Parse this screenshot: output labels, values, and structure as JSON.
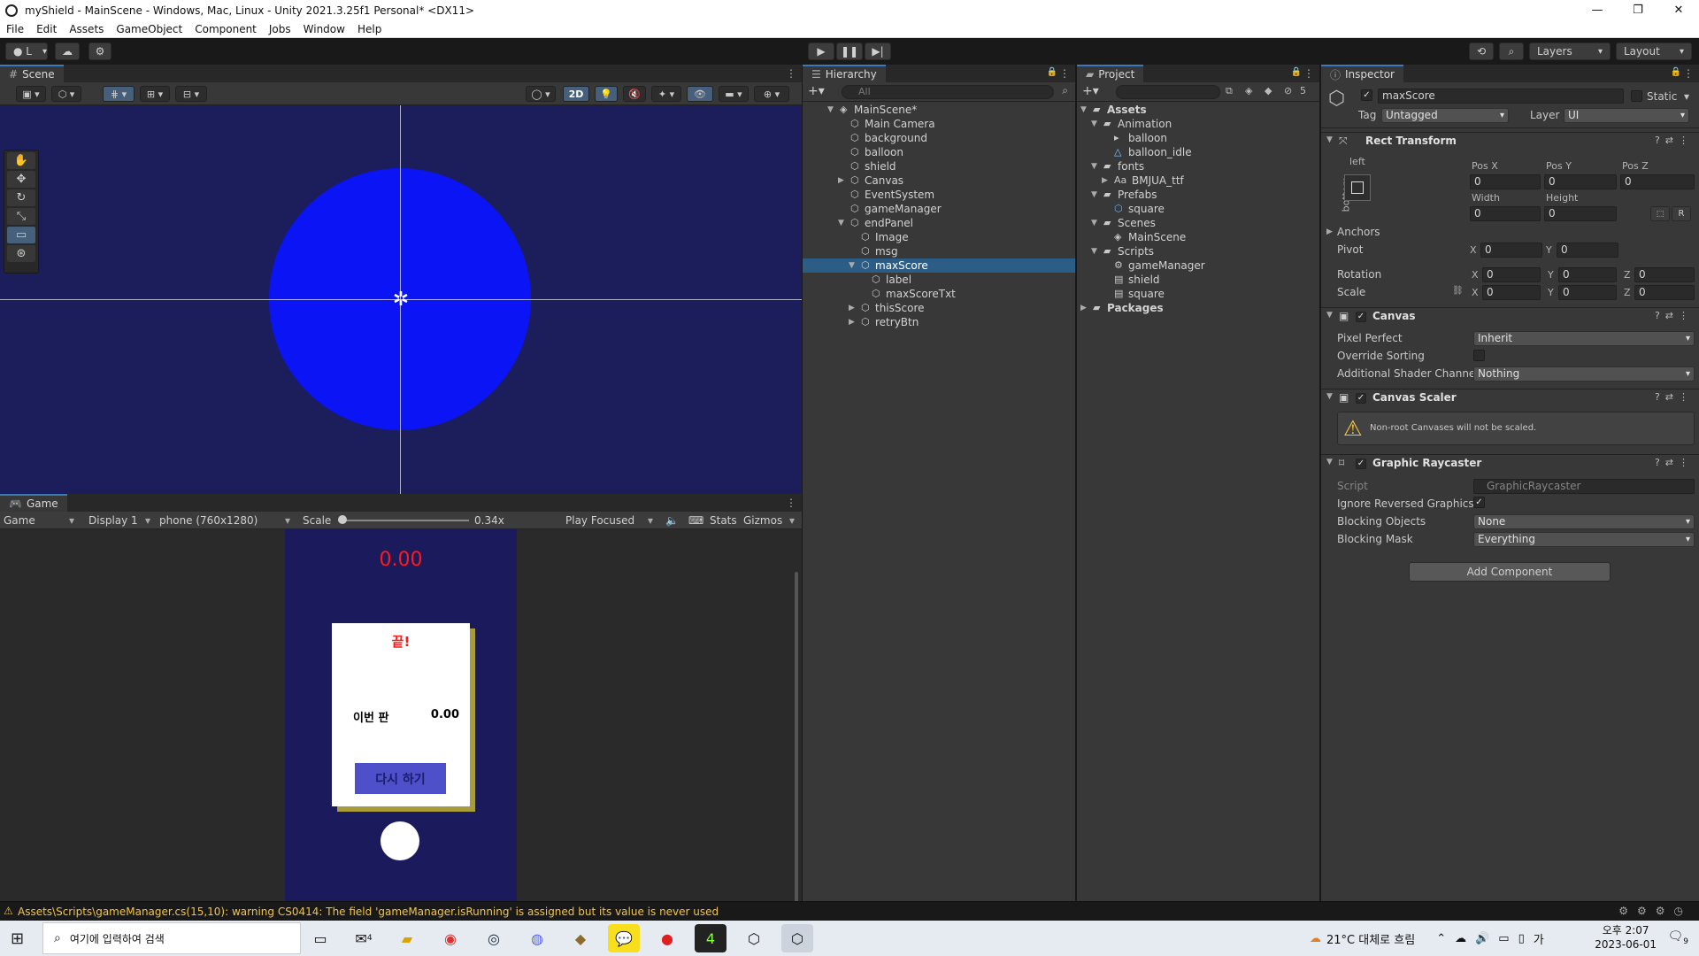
{
  "window": {
    "title": "myShield - MainScene - Windows, Mac, Linux - Unity 2021.3.25f1 Personal* <DX11>",
    "controls": [
      "—",
      "❐",
      "✕"
    ]
  },
  "menu": [
    "File",
    "Edit",
    "Assets",
    "GameObject",
    "Component",
    "Jobs",
    "Window",
    "Help"
  ],
  "toolbar": {
    "account": "L",
    "layers": "Layers",
    "layout": "Layout"
  },
  "scene": {
    "tab": "Scene",
    "mode_2d": "2D"
  },
  "game": {
    "tab": "Game",
    "view": "Game",
    "display": "Display 1",
    "resolution": "phone (760x1280)",
    "scale_label": "Scale",
    "scale_value": "0.34x",
    "play_focused": "Play Focused",
    "stats": "Stats",
    "gizmos": "Gizmos",
    "score": "0.00",
    "end_title": "끝!",
    "this_round_label": "이번 판",
    "this_round_value": "0.00",
    "retry": "다시 하기"
  },
  "hierarchy": {
    "tab": "Hierarchy",
    "search_placeholder": "All",
    "items": [
      {
        "label": "MainScene*",
        "depth": 0,
        "arrow": "open",
        "type": "scene"
      },
      {
        "label": "Main Camera",
        "depth": 1,
        "arrow": "",
        "type": "go"
      },
      {
        "label": "background",
        "depth": 1,
        "arrow": "",
        "type": "go"
      },
      {
        "label": "balloon",
        "depth": 1,
        "arrow": "",
        "type": "go"
      },
      {
        "label": "shield",
        "depth": 1,
        "arrow": "",
        "type": "go"
      },
      {
        "label": "Canvas",
        "depth": 1,
        "arrow": "closed",
        "type": "go"
      },
      {
        "label": "EventSystem",
        "depth": 1,
        "arrow": "",
        "type": "go"
      },
      {
        "label": "gameManager",
        "depth": 1,
        "arrow": "",
        "type": "go"
      },
      {
        "label": "endPanel",
        "depth": 1,
        "arrow": "open",
        "type": "go"
      },
      {
        "label": "Image",
        "depth": 2,
        "arrow": "",
        "type": "go"
      },
      {
        "label": "msg",
        "depth": 2,
        "arrow": "",
        "type": "go"
      },
      {
        "label": "maxScore",
        "depth": 2,
        "arrow": "open",
        "type": "go",
        "selected": true
      },
      {
        "label": "label",
        "depth": 3,
        "arrow": "",
        "type": "go"
      },
      {
        "label": "maxScoreTxt",
        "depth": 3,
        "arrow": "",
        "type": "go"
      },
      {
        "label": "thisScore",
        "depth": 2,
        "arrow": "closed",
        "type": "go"
      },
      {
        "label": "retryBtn",
        "depth": 2,
        "arrow": "closed",
        "type": "go"
      }
    ]
  },
  "project": {
    "tab": "Project",
    "hidden_count": "5",
    "items": [
      {
        "label": "Assets",
        "depth": 0,
        "arrow": "open",
        "type": "folder",
        "bold": true
      },
      {
        "label": "Animation",
        "depth": 1,
        "arrow": "open",
        "type": "folder"
      },
      {
        "label": "balloon",
        "depth": 2,
        "arrow": "",
        "type": "anim"
      },
      {
        "label": "balloon_idle",
        "depth": 2,
        "arrow": "",
        "type": "clip"
      },
      {
        "label": "fonts",
        "depth": 1,
        "arrow": "open",
        "type": "folder"
      },
      {
        "label": "BMJUA_ttf",
        "depth": 2,
        "arrow": "closed",
        "type": "font"
      },
      {
        "label": "Prefabs",
        "depth": 1,
        "arrow": "open",
        "type": "folder"
      },
      {
        "label": "square",
        "depth": 2,
        "arrow": "",
        "type": "prefab"
      },
      {
        "label": "Scenes",
        "depth": 1,
        "arrow": "open",
        "type": "folder"
      },
      {
        "label": "MainScene",
        "depth": 2,
        "arrow": "",
        "type": "scene"
      },
      {
        "label": "Scripts",
        "depth": 1,
        "arrow": "open",
        "type": "folder"
      },
      {
        "label": "gameManager",
        "depth": 2,
        "arrow": "",
        "type": "gear"
      },
      {
        "label": "shield",
        "depth": 2,
        "arrow": "",
        "type": "script"
      },
      {
        "label": "square",
        "depth": 2,
        "arrow": "",
        "type": "script"
      },
      {
        "label": "Packages",
        "depth": 0,
        "arrow": "closed",
        "type": "folder",
        "bold": true
      }
    ]
  },
  "inspector": {
    "tab": "Inspector",
    "object_name": "maxScore",
    "static": "Static",
    "tag_label": "Tag",
    "tag": "Untagged",
    "layer_label": "Layer",
    "layer": "UI",
    "rect": {
      "title": "Rect Transform",
      "anchor_h": "left",
      "anchor_v": "bottom",
      "pos_x_label": "Pos X",
      "pos_y_label": "Pos Y",
      "pos_z_label": "Pos Z",
      "pos_x": "0",
      "pos_y": "0",
      "pos_z": "0",
      "width_label": "Width",
      "height_label": "Height",
      "width": "0",
      "height": "0",
      "anchors": "Anchors",
      "pivot": "Pivot",
      "pivot_x": "0",
      "pivot_y": "0",
      "rotation": "Rotation",
      "rot_x": "0",
      "rot_y": "0",
      "rot_z": "0",
      "scale": "Scale",
      "scale_x": "0",
      "scale_y": "0",
      "scale_z": "0",
      "raw_btn": "R"
    },
    "canvas": {
      "title": "Canvas",
      "pixel_perfect": "Pixel Perfect",
      "pixel_perfect_value": "Inherit",
      "override_sorting": "Override Sorting",
      "shader_channels": "Additional Shader Channels",
      "shader_channels_value": "Nothing"
    },
    "scaler": {
      "title": "Canvas Scaler",
      "warning": "Non-root Canvases will not be scaled."
    },
    "raycaster": {
      "title": "Graphic Raycaster",
      "script_label": "Script",
      "script_value": "GraphicRaycaster",
      "ignore_reversed": "Ignore Reversed Graphics",
      "blocking_objects": "Blocking Objects",
      "blocking_objects_value": "None",
      "blocking_mask": "Blocking Mask",
      "blocking_mask_value": "Everything"
    },
    "add_component": "Add Component"
  },
  "status": {
    "message": "Assets\\Scripts\\gameManager.cs(15,10): warning CS0414: The field 'gameManager.isRunning' is assigned but its value is never used"
  },
  "taskbar": {
    "search_placeholder": "여기에 입력하여 검색",
    "weather": "21°C  대체로 흐림",
    "time": "오후 2:07",
    "date": "2023-06-01",
    "notif_count": "9",
    "mail_count": "4"
  },
  "colors": {
    "scene_bg": "#1c1e5c",
    "balloon": "#0a14f5",
    "phone_bg": "#1a1a5c",
    "score": "#ff1a1a",
    "retry_btn": "#4d50c8",
    "selection": "#2c5d87",
    "warning": "#f4c542"
  }
}
